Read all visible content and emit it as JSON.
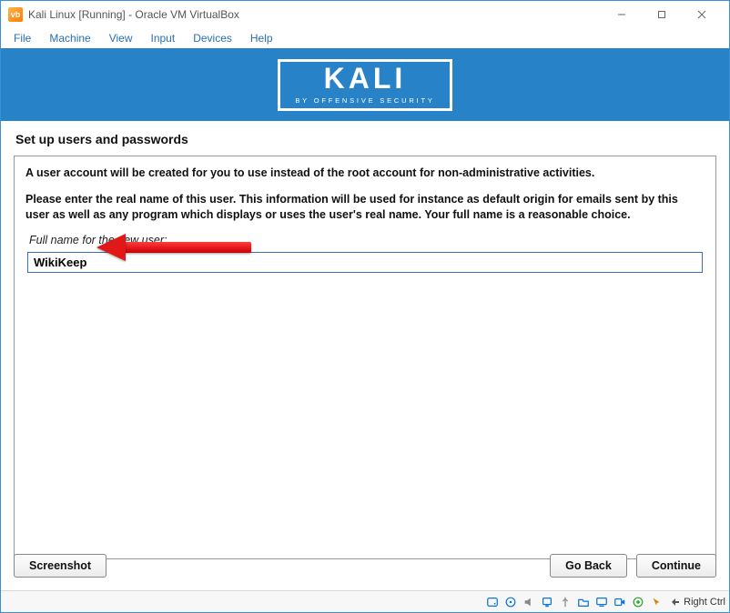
{
  "window": {
    "title": "Kali Linux [Running] - Oracle VM VirtualBox"
  },
  "menubar": {
    "file": "File",
    "machine": "Machine",
    "view": "View",
    "input": "Input",
    "devices": "Devices",
    "help": "Help"
  },
  "banner": {
    "logo_text": "KALI",
    "logo_sub": "BY OFFENSIVE SECURITY"
  },
  "installer": {
    "section_title": "Set up users and passwords",
    "para1": "A user account will be created for you to use instead of the root account for non-administrative activities.",
    "para2": "Please enter the real name of this user. This information will be used for instance as default origin for emails sent by this user as well as any program which displays or uses the user's real name. Your full name is a reasonable choice.",
    "fullname_label": "Full name for the new user:",
    "fullname_value": "WikiKeep"
  },
  "buttons": {
    "screenshot": "Screenshot",
    "go_back": "Go Back",
    "continue": "Continue"
  },
  "statusbar": {
    "host_key": "Right Ctrl"
  }
}
